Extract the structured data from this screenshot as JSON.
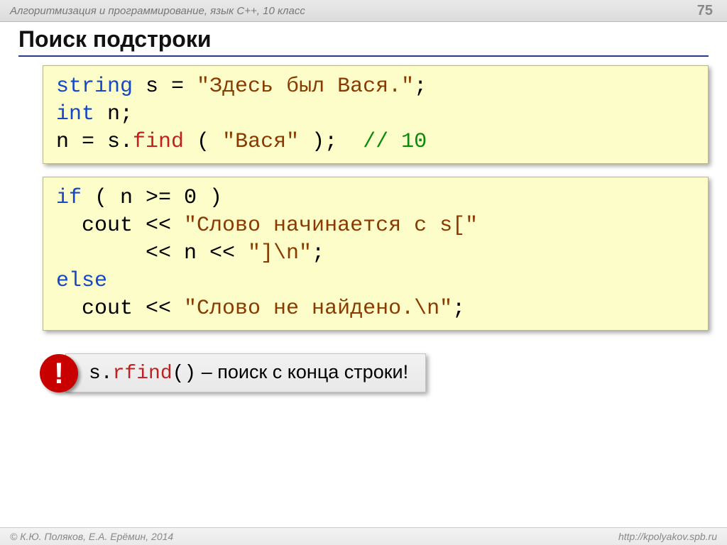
{
  "header": {
    "course": "Алгоритмизация и программирование, язык С++, 10 класс",
    "page": "75"
  },
  "slide_title": "Поиск подстроки",
  "code1": {
    "kw_string": "string",
    "var1": " s = ",
    "str1": "\"Здесь был Вася.\"",
    "semi1": ";",
    "kw_int": "int",
    "decl2": " n;",
    "assign": "n = s.",
    "fn_find": "find",
    "call_open": " ( ",
    "str2": "\"Вася\"",
    "call_close": " );  ",
    "comment": "// 10"
  },
  "code2": {
    "kw_if": "if",
    "cond": " ( n >= 0 )",
    "l2a": "  cout << ",
    "str_a": "\"Слово начинается с s[\"",
    "l3": "       << n << ",
    "str_b": "\"]\\n\"",
    "semi_b": ";",
    "kw_else": "else",
    "l5a": "  cout << ",
    "str_c": "\"Слово не найдено.\\n\"",
    "semi_c": ";"
  },
  "note": {
    "bang": "!",
    "pre": "s.",
    "fn_rfind": "rfind",
    "post": "()",
    "tail": " – поиск с конца строки!"
  },
  "footer": {
    "left": "© К.Ю. Поляков, Е.А. Ерёмин, 2014",
    "right": "http://kpolyakov.spb.ru"
  }
}
